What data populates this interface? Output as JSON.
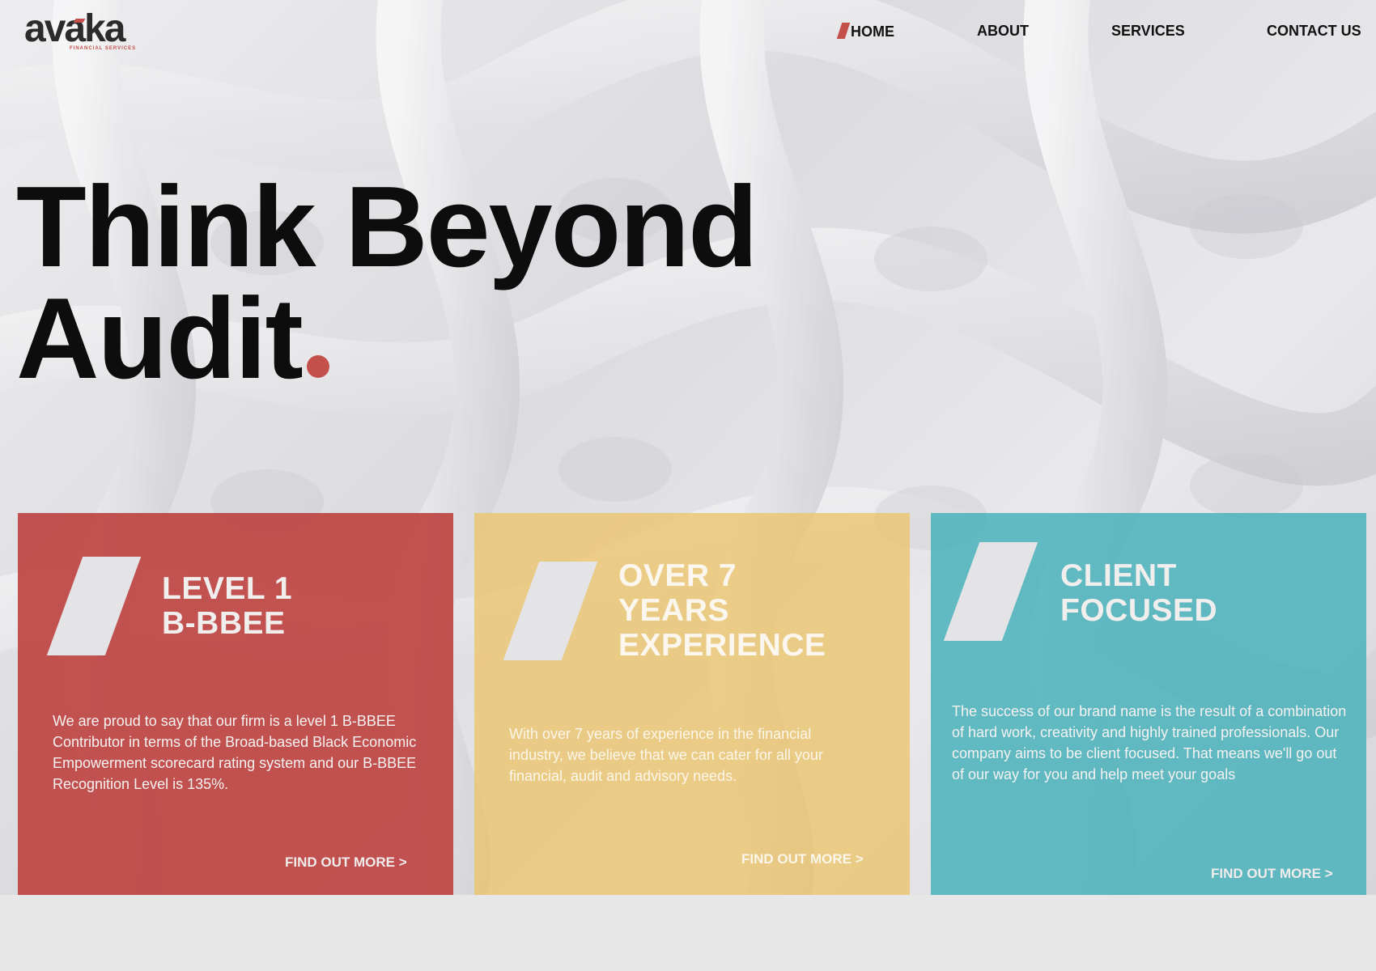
{
  "brand": {
    "name": "avaka",
    "tagline": "FINANCIAL SERVICES",
    "accent_color": "#c4504c"
  },
  "nav": {
    "items": [
      {
        "label": "HOME",
        "active": true
      },
      {
        "label": "ABOUT",
        "active": false
      },
      {
        "label": "SERVICES",
        "active": false
      },
      {
        "label": "CONTACT US",
        "active": false
      }
    ]
  },
  "hero": {
    "headline_line1": "Think Beyond",
    "headline_line2": "Audit"
  },
  "cards": [
    {
      "title_line1": "LEVEL 1",
      "title_line2": "B-BBEE",
      "body": "We are proud to say that our firm is a level 1 B-BBEE Contributor in terms of the Broad-based Black Economic Empowerment scorecard rating system and our B-BBEE Recognition Level is 135%.",
      "link": "FIND OUT MORE >",
      "color": "#be4644"
    },
    {
      "title_line1": "OVER 7",
      "title_line2": "YEARS",
      "title_line3": "EXPERIENCE",
      "body": "With over 7 years of experience in the financial industry, we believe that we can cater for all your financial, audit and advisory needs.",
      "link": "FIND OUT MORE >",
      "color": "#ecc46a"
    },
    {
      "title_line1": "CLIENT",
      "title_line2": "FOCUSED",
      "body": "The success of our brand name is the result of a combination of hard work, creativity and highly trained professionals. Our company aims to be client focused. That means we'll go out of our way for you and help meet your goals",
      "link": "FIND OUT MORE >",
      "color": "#4ab2ba"
    }
  ]
}
